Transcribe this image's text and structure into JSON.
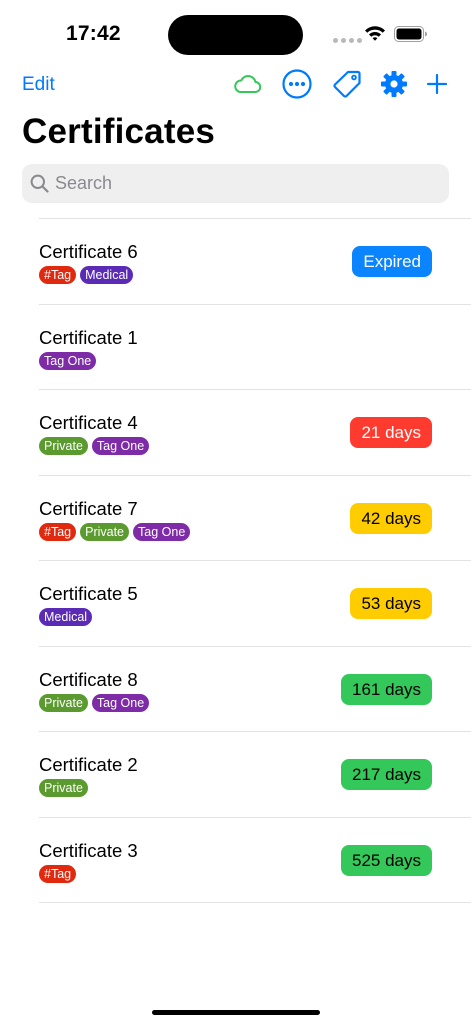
{
  "status": {
    "time": "17:42"
  },
  "nav": {
    "edit_label": "Edit",
    "icons": [
      "cloud-icon",
      "more-icon",
      "tag-icon",
      "gear-icon",
      "plus-icon"
    ]
  },
  "page": {
    "title": "Certificates"
  },
  "search": {
    "placeholder": "Search",
    "value": ""
  },
  "colors": {
    "accent": "#007aff",
    "cloud": "#34c759",
    "tag_hash": "#e0290f",
    "tag_medical": "#5b2bb5",
    "tag_tag_one": "#7e2ba8",
    "tag_private": "#5b9a2f",
    "badge_expired": "#0a84ff",
    "badge_red": "#ff3b30",
    "badge_yellow": "#ffcc00",
    "badge_green": "#34c759"
  },
  "certificates": [
    {
      "name": "Certificate 6",
      "tags": [
        {
          "label": "#Tag",
          "color": "#e0290f"
        },
        {
          "label": "Medical",
          "color": "#5b2bb5"
        }
      ],
      "badge": {
        "text": "Expired",
        "bg": "#0a84ff",
        "fg": "#ffffff"
      }
    },
    {
      "name": "Certificate 1",
      "tags": [
        {
          "label": "Tag One",
          "color": "#7e2ba8"
        }
      ],
      "badge": null
    },
    {
      "name": "Certificate 4",
      "tags": [
        {
          "label": "Private",
          "color": "#5b9a2f"
        },
        {
          "label": "Tag One",
          "color": "#7e2ba8"
        }
      ],
      "badge": {
        "text": "21 days",
        "bg": "#ff3b30",
        "fg": "#ffffff"
      }
    },
    {
      "name": "Certificate 7",
      "tags": [
        {
          "label": "#Tag",
          "color": "#e0290f"
        },
        {
          "label": "Private",
          "color": "#5b9a2f"
        },
        {
          "label": "Tag One",
          "color": "#7e2ba8"
        }
      ],
      "badge": {
        "text": "42 days",
        "bg": "#ffcc00",
        "fg": "#000000"
      }
    },
    {
      "name": "Certificate 5",
      "tags": [
        {
          "label": "Medical",
          "color": "#5b2bb5"
        }
      ],
      "badge": {
        "text": "53 days",
        "bg": "#ffcc00",
        "fg": "#000000"
      }
    },
    {
      "name": "Certificate 8",
      "tags": [
        {
          "label": "Private",
          "color": "#5b9a2f"
        },
        {
          "label": "Tag One",
          "color": "#7e2ba8"
        }
      ],
      "badge": {
        "text": "161 days",
        "bg": "#34c759",
        "fg": "#000000"
      }
    },
    {
      "name": "Certificate 2",
      "tags": [
        {
          "label": "Private",
          "color": "#5b9a2f"
        }
      ],
      "badge": {
        "text": "217 days",
        "bg": "#34c759",
        "fg": "#000000"
      }
    },
    {
      "name": "Certificate 3",
      "tags": [
        {
          "label": "#Tag",
          "color": "#e0290f"
        }
      ],
      "badge": {
        "text": "525 days",
        "bg": "#34c759",
        "fg": "#000000"
      }
    }
  ]
}
